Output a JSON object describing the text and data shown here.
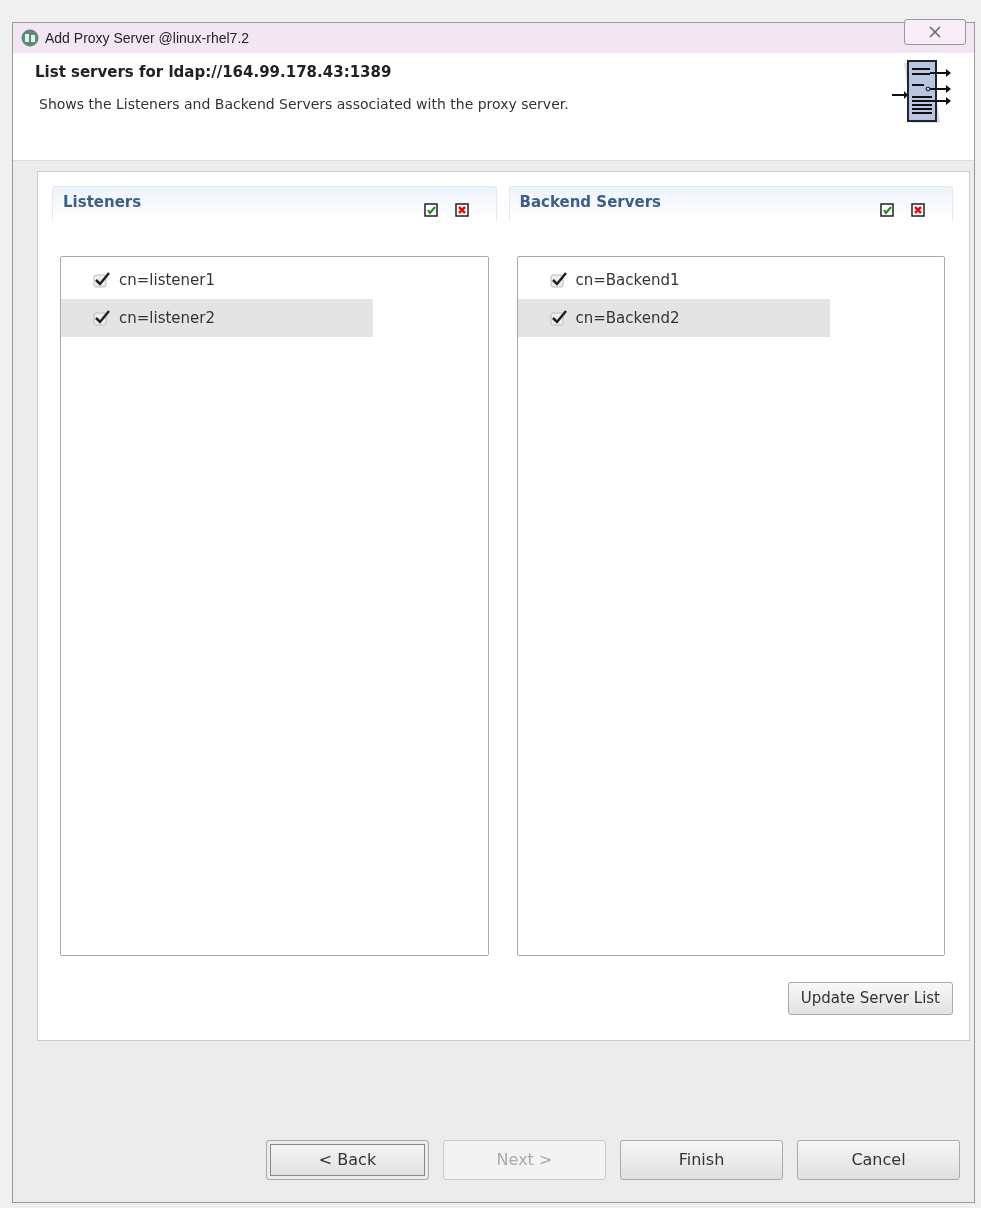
{
  "window": {
    "title": "Add Proxy Server @linux-rhel7.2"
  },
  "header": {
    "title": "List servers for ldap://164.99.178.43:1389",
    "description": "Shows the Listeners and Backend Servers associated with the proxy server."
  },
  "panels": [
    {
      "title": "Listeners",
      "items": [
        {
          "label": "cn=listener1",
          "checked": true,
          "selected": false
        },
        {
          "label": "cn=listener2",
          "checked": true,
          "selected": true
        }
      ]
    },
    {
      "title": "Backend Servers",
      "items": [
        {
          "label": "cn=Backend1",
          "checked": true,
          "selected": false
        },
        {
          "label": "cn=Backend2",
          "checked": true,
          "selected": true
        }
      ]
    }
  ],
  "update_button": "Update Server List",
  "buttons": [
    {
      "label": "< Back",
      "disabled": false,
      "default": true
    },
    {
      "label": "Next >",
      "disabled": true,
      "default": false
    },
    {
      "label": "Finish",
      "disabled": false,
      "default": false
    },
    {
      "label": "Cancel",
      "disabled": false,
      "default": false
    }
  ]
}
